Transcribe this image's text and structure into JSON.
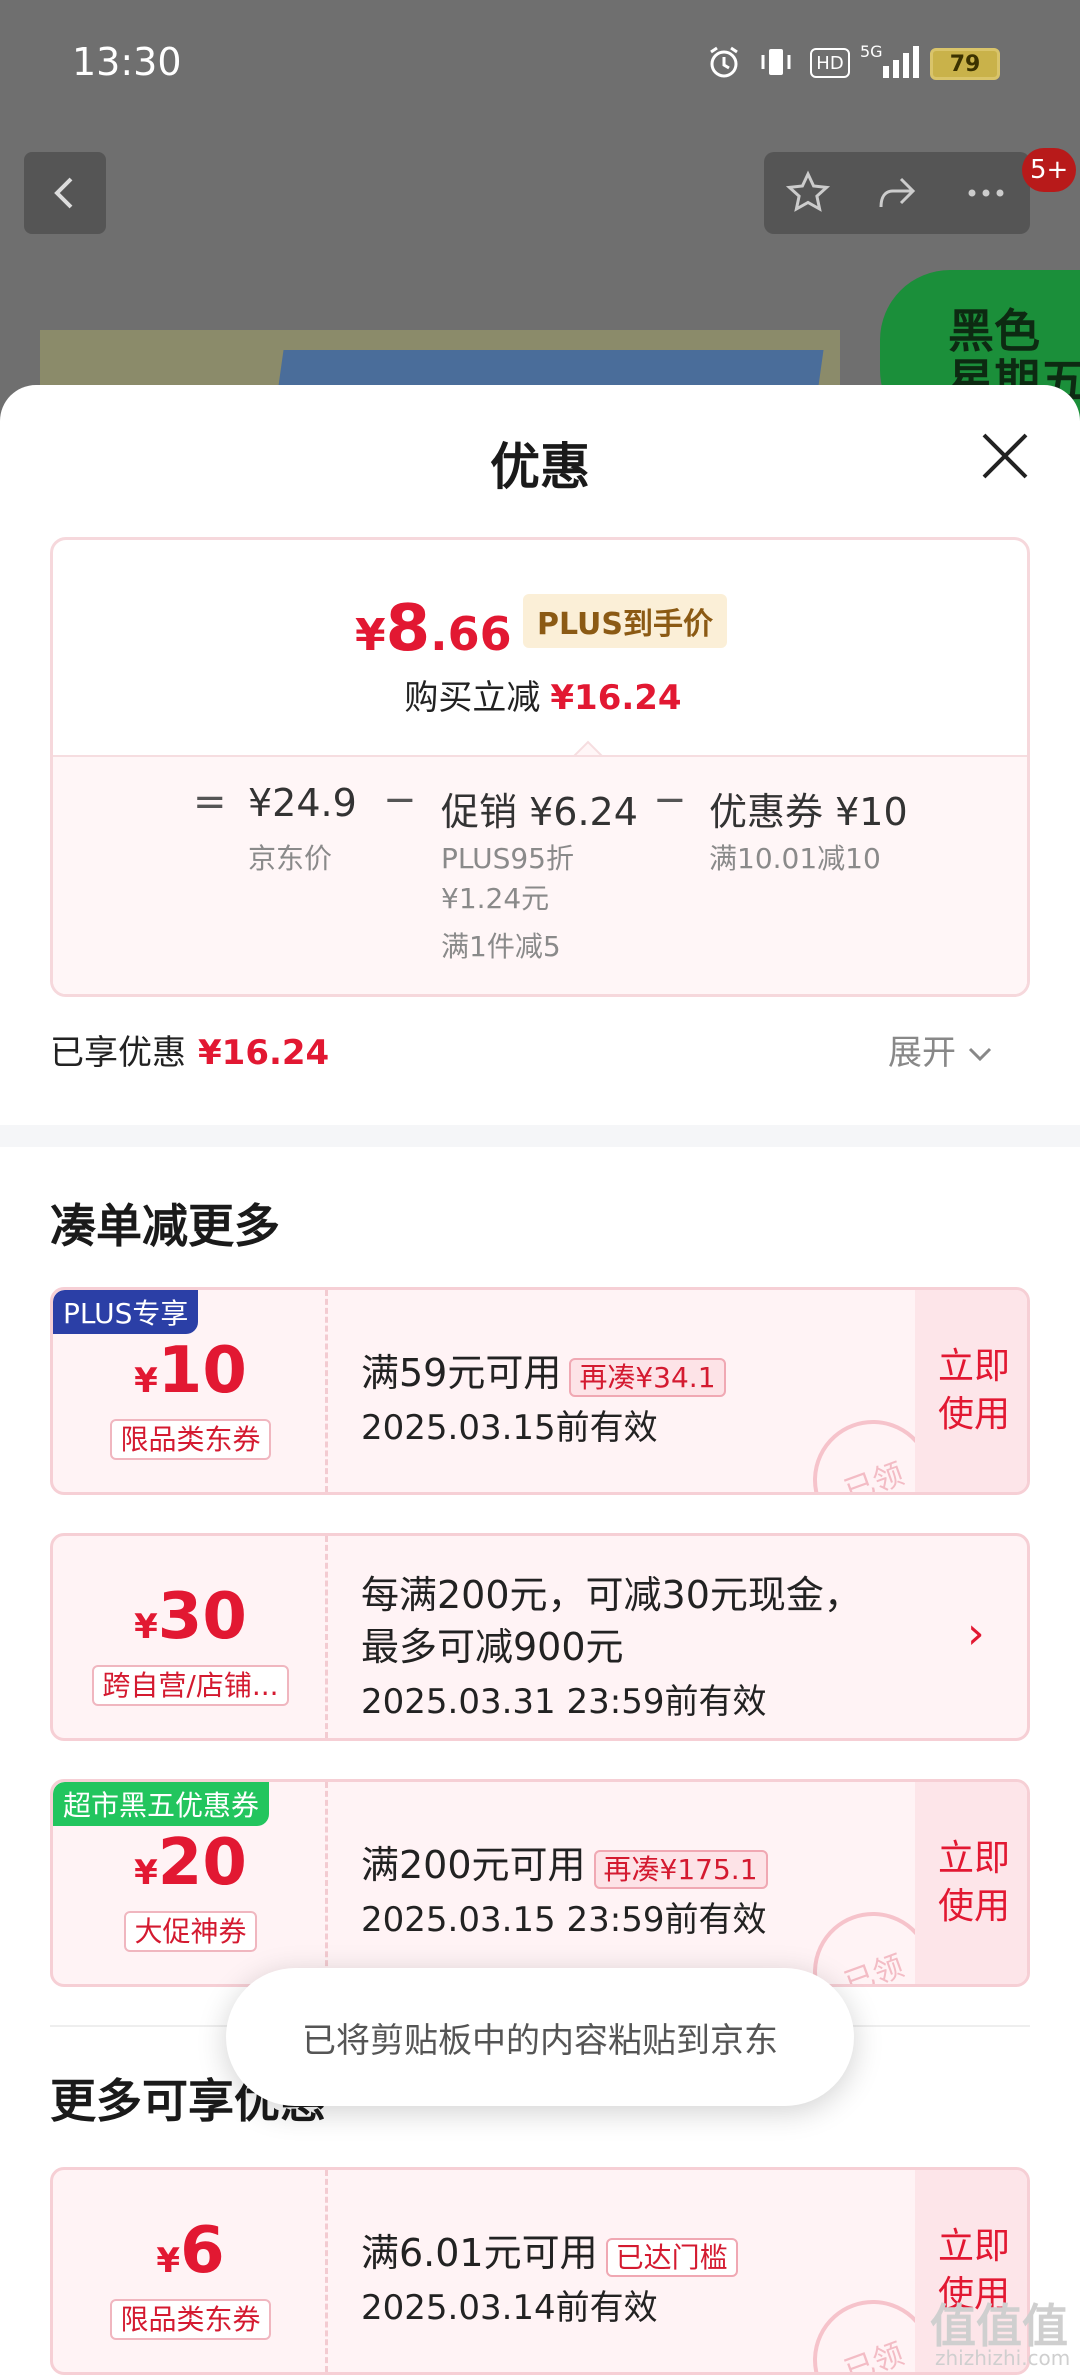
{
  "status_bar": {
    "time": "13:30",
    "network": "5G",
    "hd": "HD",
    "battery": "79"
  },
  "header": {
    "back_icon": "back-arrow-icon",
    "notification_badge": "5+",
    "promo_text": "黑色\n星期五"
  },
  "sheet": {
    "title": "优惠",
    "price_card": {
      "currency": "¥",
      "price_int": "8",
      "price_dec": ".66",
      "plus_tag": "PLUS到手价",
      "reduce_label": "购买立减",
      "reduce_value": "¥16.24",
      "formula": {
        "eq": "=",
        "jd_price": "¥24.9",
        "jd_price_label": "京东价",
        "minus1": "−",
        "promo_label": "促销",
        "promo_value": "¥6.24",
        "promo_detail1": "PLUS95折",
        "promo_detail2": "¥1.24元",
        "promo_detail3": "满1件减5",
        "minus2": "−",
        "coupon_label": "优惠券",
        "coupon_value": "¥10",
        "coupon_detail": "满10.01减10"
      }
    },
    "enjoyed_label": "已享优惠",
    "enjoyed_value": "¥16.24",
    "expand_label": "展开",
    "section1_title": "凑单减更多",
    "coupons": [
      {
        "badge": "PLUS专享",
        "badge_color": "#2b3fa6",
        "currency": "¥",
        "amount": "10",
        "type": "限品类东券",
        "line1": "满59元可用",
        "tag": "再凑¥34.1",
        "date": "2025.03.15前有效",
        "action": "立即\n使用",
        "stamp": "已领"
      },
      {
        "badge": "",
        "currency": "¥",
        "amount": "30",
        "type": "跨自营/店铺...",
        "line1": "每满200元，可减30元现金，",
        "line2": "最多可减900元",
        "date": "2025.03.31 23:59前有效",
        "action": "›"
      },
      {
        "badge": "超市黑五优惠券",
        "badge_color": "#22c55e",
        "currency": "¥",
        "amount": "20",
        "type": "大促神券",
        "line1": "满200元可用",
        "tag": "再凑¥175.1",
        "date": "2025.03.15 23:59前有效",
        "action": "立即\n使用",
        "stamp": "已领"
      }
    ],
    "section2_title": "更多可享优惠",
    "coupons2": [
      {
        "currency": "¥",
        "amount": "6",
        "type": "限品类东券",
        "line1": "满6.01元可用",
        "tag": "已达门槛",
        "date": "2025.03.14前有效",
        "action": "立即\n使用",
        "stamp": "已领"
      }
    ]
  },
  "toast": "已将剪贴板中的内容粘贴到京东",
  "watermark": "值值值",
  "watermark_sub": "zhizhizhi.com",
  "colors": {
    "accent_red": "#e21832",
    "plus_blue": "#2b3fa6",
    "green": "#22c55e"
  }
}
